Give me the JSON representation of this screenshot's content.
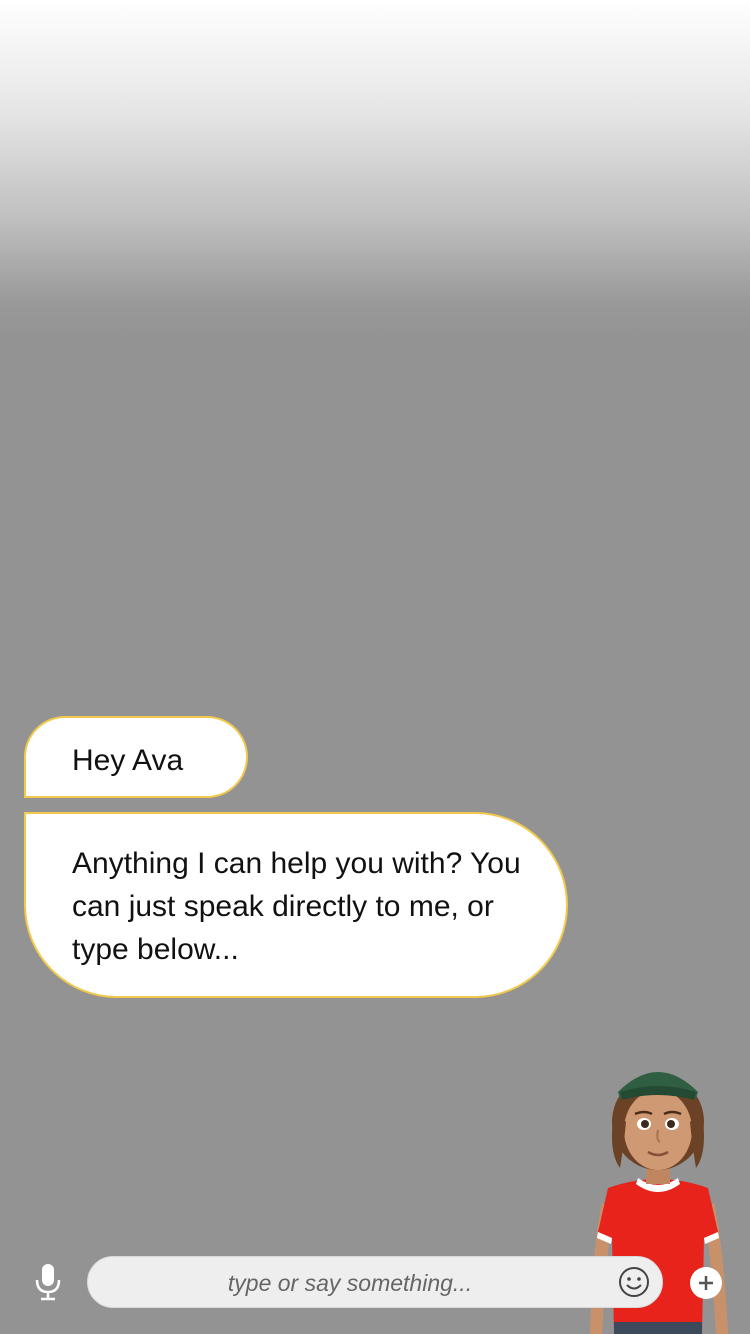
{
  "chat": {
    "messages": [
      {
        "sender": "user",
        "text": "Hey Ava"
      },
      {
        "sender": "assistant",
        "text": "Anything I can help you with? You can just speak directly to me, or type below..."
      }
    ]
  },
  "avatar": {
    "name": "Ava",
    "shirt_color": "#e8231c",
    "cap_color": "#2f5e43"
  },
  "input": {
    "placeholder": "type or say something...",
    "value": ""
  },
  "icons": {
    "mic": "microphone-icon",
    "emoji": "smiley-face-icon",
    "add": "plus-icon"
  },
  "colors": {
    "bubble_border": "#f2c94c",
    "background": "#939393"
  }
}
